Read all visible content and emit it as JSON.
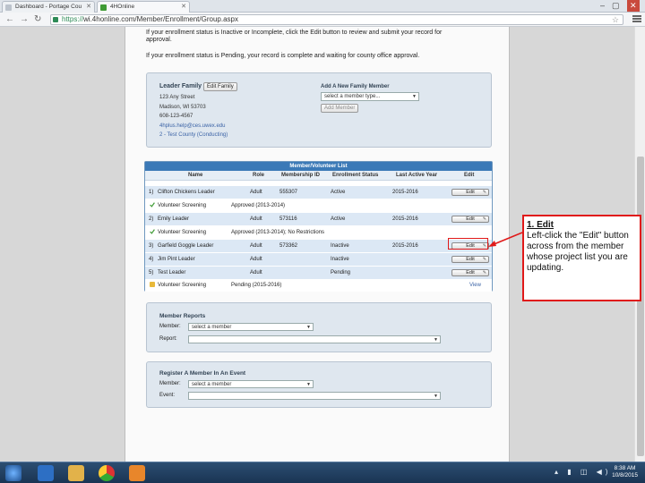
{
  "browser": {
    "tabs": [
      {
        "label": "Dashboard - Portage Cou"
      },
      {
        "label": "4HOnline"
      }
    ],
    "url_scheme": "https://",
    "url_rest": "wi.4honline.com/Member/Enrollment/Group.aspx"
  },
  "messages": {
    "inactive_line1": "If your enrollment status is Inactive or Incomplete, click the Edit button to review and submit your record for",
    "inactive_line2": "approval.",
    "pending": "If your enrollment status is Pending, your record is complete and waiting for county office approval."
  },
  "leader": {
    "title": "Leader Family",
    "edit_label": "Edit Family",
    "street": "123 Any Street",
    "city": "Madison, WI 53703",
    "phone": "608-123-4567",
    "email": "4hplus.help@ces.uwex.edu",
    "county": "2 - Test County (Conducting)",
    "add_member_title": "Add A New Family Member",
    "member_type_placeholder": "select a member type...",
    "add_member_button": "Add Member"
  },
  "table": {
    "title": "Member/Volunteer List",
    "headers": [
      "Name",
      "Role",
      "Membership ID",
      "Enrollment Status",
      "Last Active Year",
      "Edit"
    ],
    "edit_label": "Edit",
    "view_label": "View",
    "rows": [
      {
        "num": "1)",
        "name": "Clifton Chickens Leader",
        "role": "Adult",
        "id": "555307",
        "status": "Active",
        "year": "2015-2016"
      },
      {
        "sub": "Volunteer Screening",
        "subval": "Approved (2013-2014)"
      },
      {
        "num": "2)",
        "name": "Emily Leader",
        "role": "Adult",
        "id": "573116",
        "status": "Active",
        "year": "2015-2016"
      },
      {
        "sub": "Volunteer Screening",
        "subval": "Approved (2013-2014); No Restrictions"
      },
      {
        "num": "3)",
        "name": "Garfield Goggle Leader",
        "role": "Adult",
        "id": "573362",
        "status": "Inactive",
        "year": "2015-2016"
      },
      {
        "num": "4)",
        "name": "Jim Pint Leader",
        "role": "Adult",
        "id": "",
        "status": "Inactive",
        "year": ""
      },
      {
        "num": "5)",
        "name": "Test Leader",
        "role": "Adult",
        "id": "",
        "status": "Pending",
        "year": ""
      },
      {
        "sub": "Volunteer Screening",
        "subval": "Pending (2015-2016)"
      }
    ]
  },
  "reports": {
    "title": "Member Reports",
    "member_label": "Member:",
    "member_value": "select a member",
    "report_label": "Report:"
  },
  "event": {
    "title": "Register A Member In An Event",
    "member_label": "Member:",
    "member_value": "select a member",
    "event_label": "Event:"
  },
  "callout": {
    "title": "1. Edit",
    "body": "Left-click the \"Edit\" button across from the member whose project list you are updating."
  },
  "taskbar": {
    "time": "8:38 AM",
    "date": "10/8/2015"
  },
  "colors": {
    "accent": "#3b79b7",
    "callout_border": "#e01919",
    "check": "#3f9b35"
  }
}
